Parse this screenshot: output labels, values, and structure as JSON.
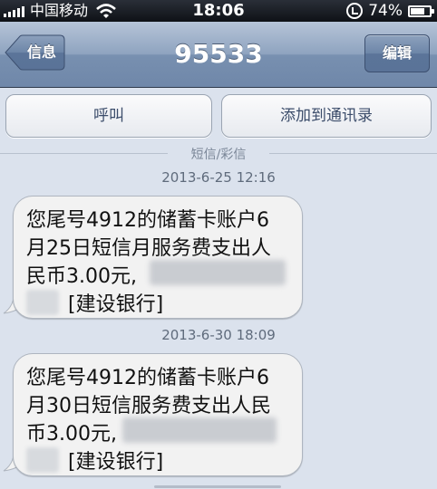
{
  "status_bar": {
    "carrier": "中国移动",
    "time": "18:06",
    "battery_percent_text": "74%",
    "battery_level": 0.74
  },
  "nav": {
    "back_label": "信息",
    "title": "95533",
    "edit_label": "编辑"
  },
  "actions": {
    "call_label": "呼叫",
    "add_contact_label": "添加到通讯录"
  },
  "thread": {
    "divider_label": "短信/彩信",
    "messages": [
      {
        "timestamp": "2013-6-25 12:16",
        "lines": [
          "您尾号4912的储蓄卡账户6",
          "月25日短信月服务费支出人",
          "民币3.00元,",
          "[建设银行]"
        ]
      },
      {
        "timestamp": "2013-6-30 18:09",
        "lines": [
          "您尾号4912的储蓄卡账户6",
          "月30日短信服务费支出人民",
          "币3.00元,",
          "[建设银行]"
        ]
      }
    ]
  },
  "colors": {
    "nav_bar": "#7a91b2",
    "background": "#dbe2ed",
    "bubble": "#f2f2f2",
    "action_text": "#3c4d6b"
  }
}
